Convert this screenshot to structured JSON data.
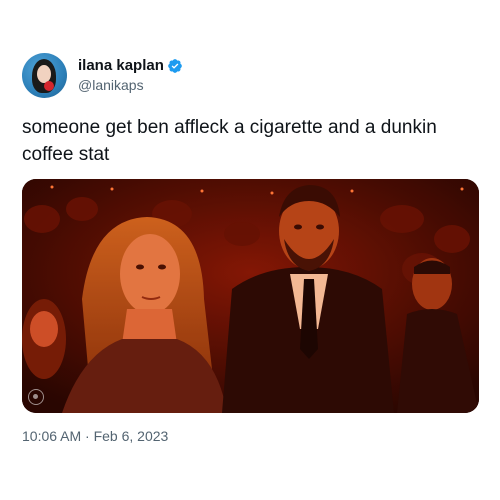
{
  "author": {
    "display_name": "ilana kaplan",
    "handle": "@lanikaps",
    "verified": true
  },
  "tweet": {
    "text": "someone get ben affleck a cigarette and a dunkin coffee stat",
    "timestamp": "10:06 AM · Feb 6, 2023"
  },
  "media": {
    "type": "photo",
    "badge_icon": "cbs-eye-icon"
  },
  "colors": {
    "verified_blue": "#1d9bf0",
    "text_primary": "#0f1419",
    "text_secondary": "#536471",
    "photo_tint": "#b0200c"
  }
}
